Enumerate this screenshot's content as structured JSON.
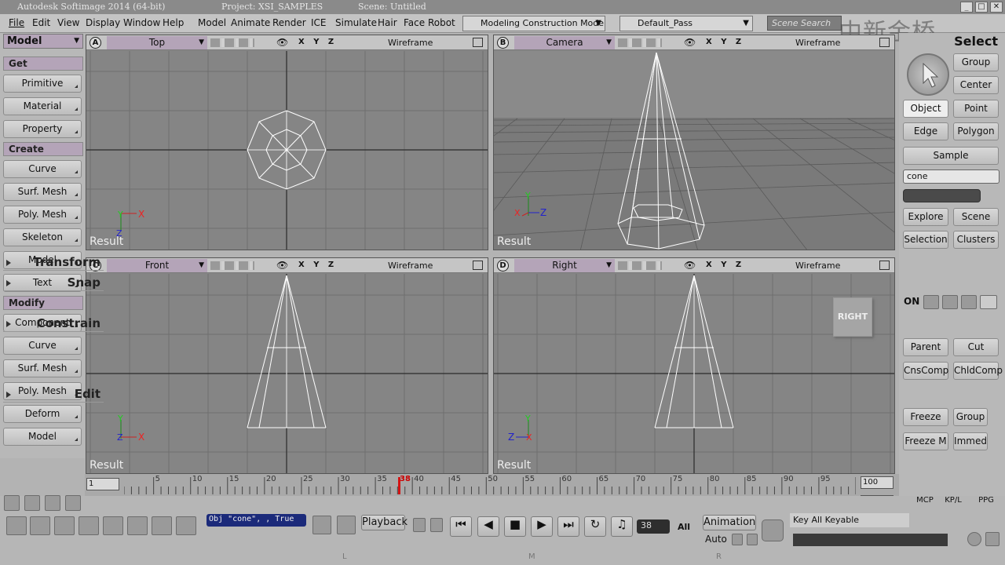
{
  "titlebar": {
    "app": "Autodesk Softimage 2014 (64-bit)",
    "project": "Project: XSI_SAMPLES",
    "scene": "Scene: Untitled"
  },
  "menu": [
    "File",
    "Edit",
    "View",
    "Display",
    "Window",
    "Help",
    "Model",
    "Animate",
    "Render",
    "ICE",
    "Simulate",
    "Hair",
    "Face Robot"
  ],
  "mode_combo": "Modeling Construction Mode",
  "pass_combo": "Default_Pass",
  "search_placeholder": "Scene Search",
  "watermark": "中新金桥",
  "left": {
    "mode": "Model",
    "sections": [
      {
        "title": "Get",
        "items": [
          "Primitive",
          "Material",
          "Property"
        ]
      },
      {
        "title": "Create",
        "items": [
          "Curve",
          "Surf. Mesh",
          "Poly. Mesh",
          "Skeleton",
          "Model",
          "Text"
        ]
      },
      {
        "title": "Modify",
        "items": [
          "Component",
          "Curve",
          "Surf. Mesh",
          "Poly. Mesh",
          "Deform",
          "Model"
        ]
      }
    ]
  },
  "viewports": [
    {
      "letter": "A",
      "view": "Top",
      "mode": "Wireframe",
      "axes": "X Y Z",
      "result": "Result"
    },
    {
      "letter": "B",
      "view": "Camera",
      "mode": "Wireframe",
      "axes": "X Y Z",
      "result": "Result"
    },
    {
      "letter": "C",
      "view": "Front",
      "mode": "Wireframe",
      "axes": "X Y Z",
      "result": "Result"
    },
    {
      "letter": "D",
      "view": "Right",
      "mode": "Wireframe",
      "axes": "X Y Z",
      "result": "Result",
      "cube_label": "RIGHT"
    }
  ],
  "right": {
    "select_title": "Select",
    "group": "Group",
    "center": "Center",
    "object": "Object",
    "point": "Point",
    "edge": "Edge",
    "polygon": "Polygon",
    "sample": "Sample",
    "name_field": "cone",
    "explore": "Explore",
    "scene": "Scene",
    "selection": "Selection",
    "clusters": "Clusters",
    "transform": "Transform",
    "snap": "Snap",
    "snap_on": "ON",
    "constrain": "Constrain",
    "parent": "Parent",
    "cut": "Cut",
    "cnscomp": "CnsComp",
    "chldcomp": "ChldComp",
    "edit": "Edit",
    "freeze": "Freeze",
    "group2": "Group",
    "freezem": "Freeze M",
    "immed": "Immed",
    "tabs": [
      "MCP",
      "KP/L",
      "PPG"
    ]
  },
  "timeline": {
    "start": "1",
    "end": "100",
    "range_end": "100",
    "current": "38",
    "range_start": "1",
    "range_start2": "1",
    "range_end2": "100",
    "ticks": [
      "5",
      "10",
      "15",
      "20",
      "25",
      "30",
      "35",
      "40",
      "45",
      "50",
      "55",
      "60",
      "65",
      "70",
      "75",
      "80",
      "85",
      "90",
      "95"
    ]
  },
  "bottom": {
    "script_line": "Obj \"cone\", , True",
    "playback": "Playback",
    "frame": "38",
    "all": "All",
    "animation": "Animation",
    "auto": "Auto",
    "key_all": "Key All Keyable",
    "markers": [
      "L",
      "M",
      "R"
    ]
  }
}
